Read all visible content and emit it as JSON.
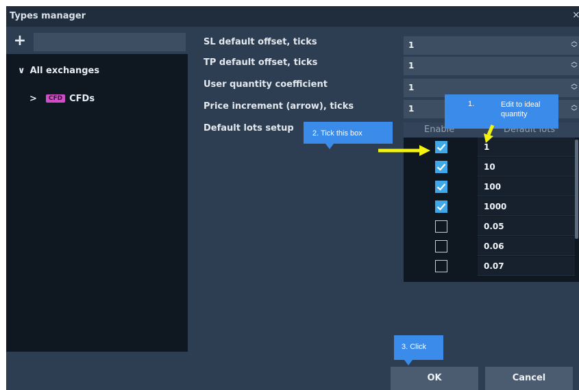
{
  "window": {
    "title": "Types manager",
    "close_glyph": "×"
  },
  "tree": {
    "add_glyph": "+",
    "search_value": "",
    "items": [
      {
        "chevron": "∨",
        "label": "All exchanges"
      },
      {
        "chevron": ">",
        "badge": "CFD",
        "label": "CFDs"
      }
    ]
  },
  "settings": [
    {
      "label": "SL default offset, ticks",
      "value": "1"
    },
    {
      "label": "TP default offset, ticks",
      "value": "1"
    },
    {
      "label": "User quantity coefficient",
      "value": "1"
    },
    {
      "label": "Price increment (arrow), ticks",
      "value": "1"
    }
  ],
  "lots": {
    "label": "Default lots setup",
    "columns": {
      "enable": "Enable",
      "default_lots": "Default lots"
    },
    "rows": [
      {
        "enabled": true,
        "value": "1"
      },
      {
        "enabled": true,
        "value": "10"
      },
      {
        "enabled": true,
        "value": "100"
      },
      {
        "enabled": true,
        "value": "1000"
      },
      {
        "enabled": false,
        "value": "0.05"
      },
      {
        "enabled": false,
        "value": "0.06"
      },
      {
        "enabled": false,
        "value": "0.07"
      }
    ]
  },
  "buttons": {
    "ok": "OK",
    "cancel": "Cancel"
  },
  "annotations": {
    "note1_num": "1.",
    "note1_text": "Edit to ideal quantity",
    "note2": "2. Tick this box",
    "note3": "3. Click",
    "callout_color": "#3b8bea",
    "arrow_color": "#f4f40e"
  },
  "colors": {
    "accent_checkbox": "#3ea8e8",
    "cfd_badge": "#d14ec8",
    "window_bg": "#2d3e52"
  }
}
